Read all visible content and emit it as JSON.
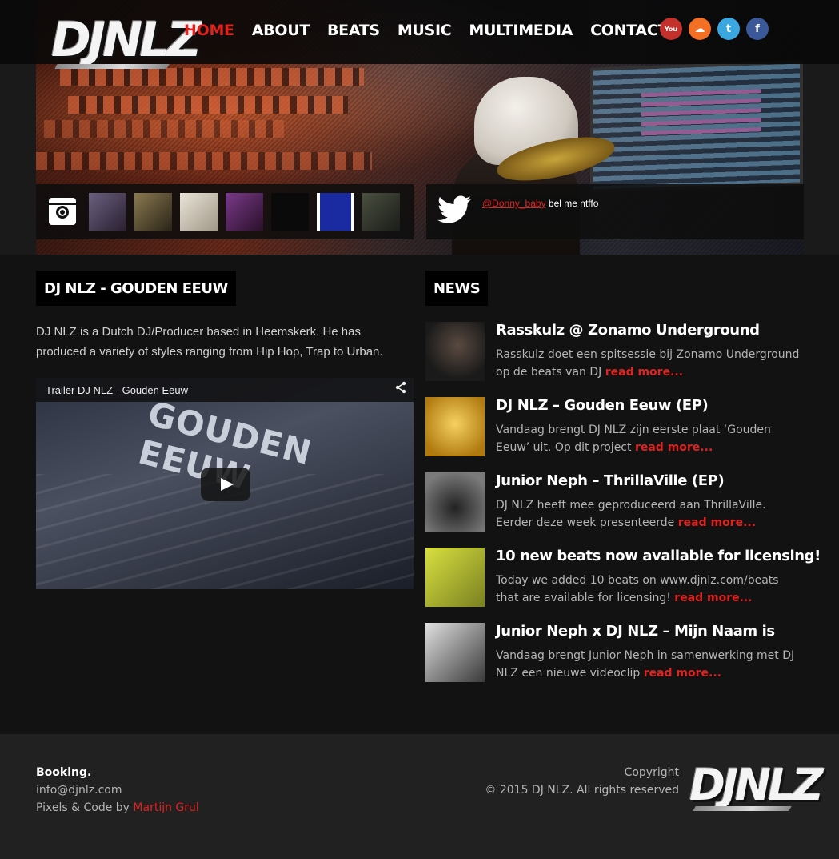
{
  "header": {
    "logo_text": "DJNLZ",
    "nav": [
      {
        "label": "HOME",
        "active": true
      },
      {
        "label": "ABOUT",
        "active": false
      },
      {
        "label": "BEATS",
        "active": false
      },
      {
        "label": "MUSIC",
        "active": false
      },
      {
        "label": "MULTIMEDIA",
        "active": false
      },
      {
        "label": "CONTACT",
        "active": false
      }
    ],
    "social": [
      {
        "name": "youtube-icon",
        "glyph": "You"
      },
      {
        "name": "soundcloud-icon",
        "glyph": "☁"
      },
      {
        "name": "twitter-icon",
        "glyph": "t"
      },
      {
        "name": "facebook-icon",
        "glyph": "f"
      }
    ]
  },
  "instagram": {
    "icon": "instagram-icon",
    "thumbs": [
      {
        "name": "instagram-thumb-1",
        "color": "#5a5070"
      },
      {
        "name": "instagram-thumb-2",
        "color": "#6a5a40"
      },
      {
        "name": "instagram-thumb-3",
        "color": "#d8d0c0"
      },
      {
        "name": "instagram-thumb-4",
        "color": "#5a2a6a"
      },
      {
        "name": "instagram-thumb-5",
        "color": "#111111"
      },
      {
        "name": "instagram-thumb-6",
        "color": "#2a3aa0"
      },
      {
        "name": "instagram-thumb-7",
        "color": "#3a4030"
      }
    ]
  },
  "tweet": {
    "icon": "twitter-bird-icon",
    "handle": "@Donny_baby",
    "text": "bel me ntffo"
  },
  "main": {
    "title": "DJ NLZ - GOUDEN EEUW",
    "intro": "DJ NLZ is a Dutch DJ/Producer based in Heemskerk. He has produced a variety of styles ranging from Hip Hop, Trap to Urban.",
    "video": {
      "title": "Trailer DJ NLZ - Gouden Eeuw",
      "overlay_text": "GOUDEN EEUW"
    }
  },
  "news": {
    "title": "NEWS",
    "items": [
      {
        "title": "Rasskulz @ Zonamo Underground",
        "excerpt": "Rasskulz doet een spitsessie bij Zonamo Underground op de beats van DJ",
        "more": "read more...",
        "thumb_color": "#2a2a2a"
      },
      {
        "title": "DJ NLZ – Gouden Eeuw (EP)",
        "excerpt": "Vandaag brengt DJ NLZ zijn eerste plaat ‘Gouden Eeuw’ uit. Op dit project",
        "more": "read more...",
        "thumb_color": "#d8a020"
      },
      {
        "title": "Junior Neph – ThrillaVille (EP)",
        "excerpt": "DJ NLZ heeft mee geproduceerd aan ThrillaVille. Eerder deze week presenteerde",
        "more": "read more...",
        "thumb_color": "#4a4a4a"
      },
      {
        "title": "10 new beats now available for licensing!",
        "excerpt": "Today we added 10 beats on www.djnlz.com/beats that are available for licensing!",
        "more": "read more...",
        "thumb_color": "#b8c030"
      },
      {
        "title": "Junior Neph x DJ NLZ – Mijn Naam is",
        "excerpt": "Vandaag brengt Junior Neph in samenwerking met DJ NLZ een nieuwe videoclip",
        "more": "read more...",
        "thumb_color": "#9a9a9a"
      }
    ]
  },
  "footer": {
    "booking_label": "Booking.",
    "email": "info@djnlz.com",
    "credit_prefix": "Pixels & Code by",
    "credit_name": "Martijn Grul",
    "copyright_label": "Copyright",
    "copyright_text": "© 2015 DJ NLZ. All rights reserved",
    "logo_text": "DJNLZ"
  }
}
